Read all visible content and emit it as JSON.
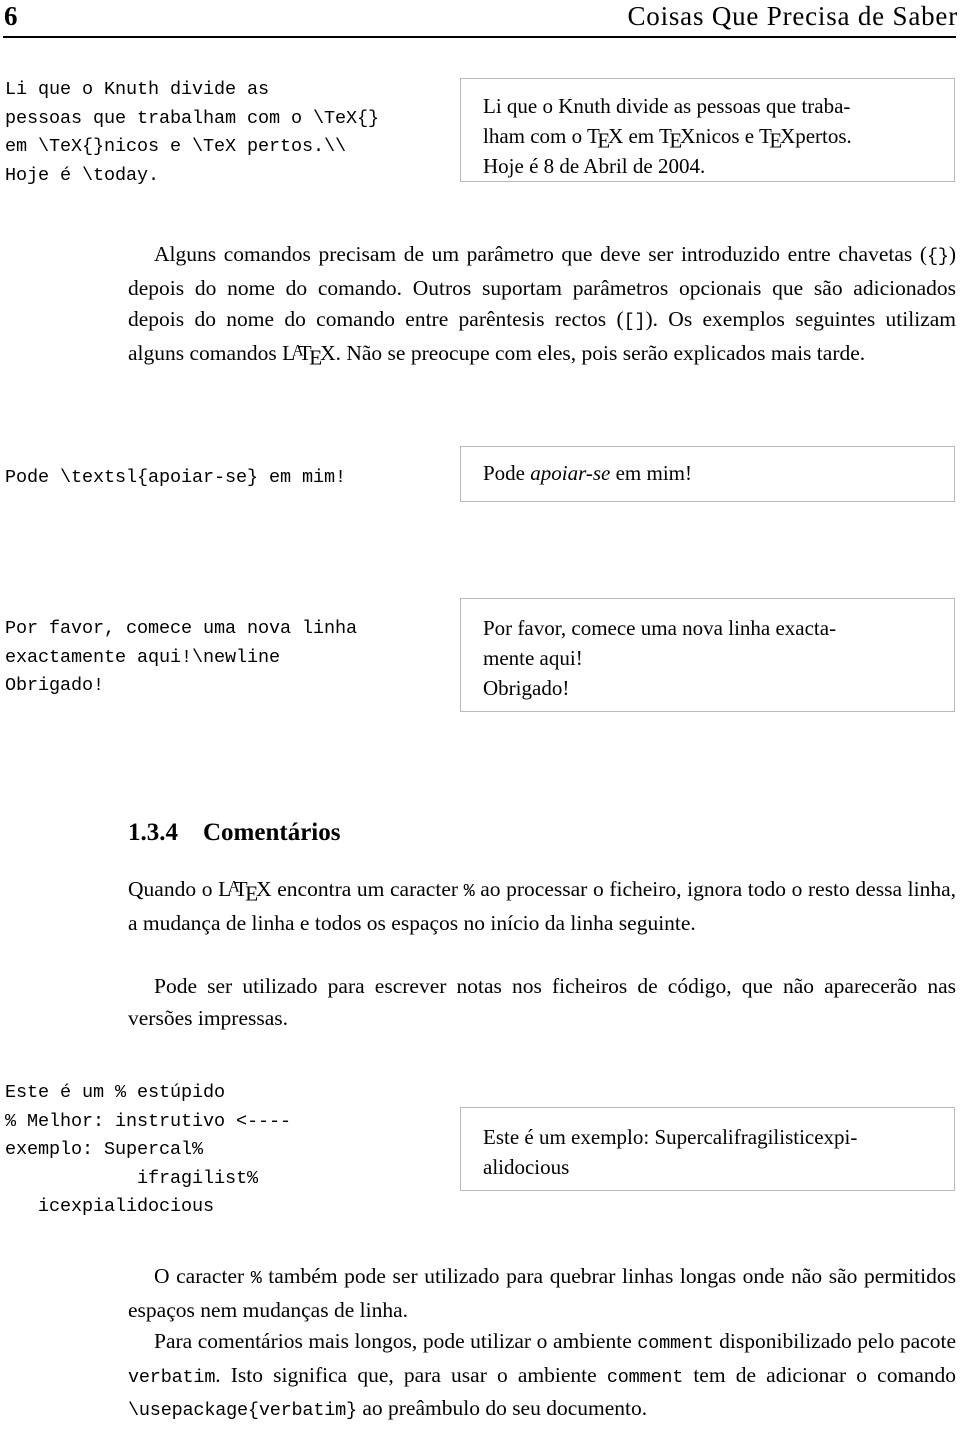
{
  "header": {
    "page_number": "6",
    "title": "Coisas Que Precisa de Saber"
  },
  "examples": [
    {
      "name": "tex-knuth",
      "source_lines": [
        "Li que o Knuth divide as",
        "pessoas que trabalham com o \\TeX{}",
        "em \\TeX{}nicos e \\TeX pertos.\\\\",
        "Hoje é \\today."
      ],
      "output_line_1_pre": "Li que o Knuth divide as pessoas que traba-",
      "output_line_2_a": "lham com o ",
      "output_line_2_b": " em ",
      "output_line_2_c": "nicos e ",
      "output_line_2_d": "pertos.",
      "output_line_3": "Hoje é 8 de Abril de 2004."
    },
    {
      "name": "textsl-apoiar-se",
      "source_lines": [
        "Pode \\textsl{apoiar-se} em mim!"
      ],
      "output_prefix": "Pode ",
      "output_slanted": "apoiar-se",
      "output_suffix": " em mim!"
    },
    {
      "name": "newline-obrigado",
      "source_lines": [
        "Por favor, comece uma nova linha",
        "exactamente aqui!\\newline",
        "Obrigado!"
      ],
      "output_line_1": "Por favor, comece uma nova linha exacta-",
      "output_line_2": "mente aqui!",
      "output_line_3": "Obrigado!"
    },
    {
      "name": "comment-percent-supercal",
      "source_lines": [
        "Este é um % estúpido",
        "% Melhor: instrutivo <----",
        "exemplo: Supercal%",
        "            ifragilist%",
        "   icexpialidocious"
      ],
      "output_line_1": "Este é um exemplo: Supercalifragilisticexpi-",
      "output_line_2": "alidocious"
    }
  ],
  "paragraphs": {
    "intro_a": "Alguns comandos precisam de um parâmetro que deve ser introduzido entre chavetas (",
    "intro_brace": "{}",
    "intro_b": ") depois do nome do comando. Outros suportam parâmetros opcionais que são adicionados depois do nome do comando entre parêntesis rectos (",
    "intro_bracket": "[]",
    "intro_c": "). Os exemplos seguintes utilizam alguns comandos ",
    "intro_d": ". Não se preocupe com eles, pois serão explicados mais tarde.",
    "comments_a": "Quando o ",
    "comments_b": " encontra um caracter ",
    "comments_pct": "%",
    "comments_c": " ao processar o ficheiro, ignora todo o resto dessa linha, a mudança de linha e todos os espaços no início da linha seguinte.",
    "comments_d": "Pode ser utilizado para escrever notas nos ficheiros de código, que não aparecerão nas versões impressas.",
    "break_a": "O caracter ",
    "break_pct": "%",
    "break_b": " também pode ser utilizado para quebrar linhas longas onde não são permitidos espaços nem mudanças de linha.",
    "verbatim_a": "Para comentários mais longos, pode utilizar o ambiente ",
    "verbatim_comment1": "comment",
    "verbatim_b": " disponibilizado pelo pacote ",
    "verbatim_pkg": "verbatim",
    "verbatim_c": ". Isto significa que, para usar o ambiente ",
    "verbatim_comment2": "comment",
    "verbatim_d": " tem de adicionar o comando ",
    "verbatim_usepackage": "\\usepackage{verbatim}",
    "verbatim_e": " ao preâmbulo do seu documento."
  },
  "section": {
    "number": "1.3.4",
    "title": "Comentários",
    "heading": "1.3.4    Comentários"
  },
  "logos": {
    "tex_t": "T",
    "tex_e": "E",
    "tex_x": "X",
    "latex_l": "L",
    "latex_a": "A",
    "latex_t": "T",
    "latex_e": "E",
    "latex_x": "X"
  }
}
